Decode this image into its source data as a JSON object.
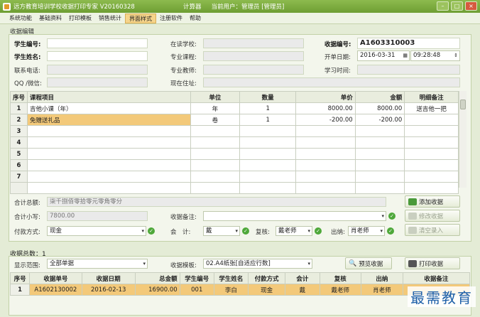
{
  "window": {
    "title": "远方教育培训学校收据打印专家 V20160328",
    "calculator": "计算器",
    "current_user": "当前用户：管理员 [管理员]"
  },
  "menu": [
    "系统功能",
    "基础资料",
    "打印模板",
    "销售统计",
    "界面样式",
    "注册软件",
    "帮助"
  ],
  "menu_active": 4,
  "editor": {
    "group_label": "收据编辑",
    "student_no_label": "学生编号:",
    "student_no": "",
    "student_name_label": "学生姓名:",
    "student_name": "",
    "phone_label": "联系电话:",
    "phone": "",
    "qq_label": "QQ /微信:",
    "qq": "",
    "school_label": "在读学校:",
    "school": "",
    "course_label": "专业课程:",
    "course": "",
    "teacher_label": "专业教师:",
    "teacher": "",
    "address_label": "现在住址:",
    "address": "",
    "receipt_no_label": "收据编号:",
    "receipt_no": "A1603310003",
    "date_label": "开单日期:",
    "date": "2016-03-31",
    "time": "09:28:48",
    "study_time_label": "学习时间:",
    "study_time": ""
  },
  "items_table": {
    "headers": [
      "序号",
      "课程项目",
      "单位",
      "数量",
      "单价",
      "金额",
      "明细备注"
    ],
    "rows": [
      {
        "no": "1",
        "item": "吉他小课（年）",
        "unit": "年",
        "qty": "1",
        "price": "8000.00",
        "amount": "8000.00",
        "note": "送吉他一把"
      },
      {
        "no": "2",
        "item": "免赠送礼品",
        "unit": "卷",
        "qty": "1",
        "price": "-200.00",
        "amount": "-200.00",
        "note": ""
      },
      {
        "no": "3",
        "item": "",
        "unit": "",
        "qty": "",
        "price": "",
        "amount": "",
        "note": ""
      },
      {
        "no": "4",
        "item": "",
        "unit": "",
        "qty": "",
        "price": "",
        "amount": "",
        "note": ""
      },
      {
        "no": "5",
        "item": "",
        "unit": "",
        "qty": "",
        "price": "",
        "amount": "",
        "note": ""
      },
      {
        "no": "6",
        "item": "",
        "unit": "",
        "qty": "",
        "price": "",
        "amount": "",
        "note": ""
      },
      {
        "no": "7",
        "item": "",
        "unit": "",
        "qty": "",
        "price": "",
        "amount": "",
        "note": ""
      }
    ]
  },
  "summary": {
    "total_upper_label": "合计总额:",
    "total_upper": "柒千捌佰零拾零元零角零分",
    "total_lower_label": "合计小写:",
    "total_lower": "7800.00",
    "remark_label": "收据备注:",
    "remark": "",
    "payment_label": "付款方式:",
    "payment": "现金",
    "accountant_label": "会　计:",
    "accountant": "戴",
    "reviewer_label": "复核:",
    "reviewer": "戴老师",
    "cashier_label": "出纳:",
    "cashier": "肖老师"
  },
  "buttons": {
    "add": "添加收据",
    "edit": "修改收据",
    "clear": "清空录入",
    "preview": "预览收据",
    "print": "打印收据"
  },
  "list": {
    "count_label": "收据总数：",
    "count": "1",
    "display_label": "显示范围:",
    "display": "全部单据",
    "template_label": "收据模板:",
    "template": "02.A4纸张[自适应行数]",
    "headers": [
      "序号",
      "收据单号",
      "收据日期",
      "总金额",
      "学生编号",
      "学生姓名",
      "付款方式",
      "会计",
      "复核",
      "出纳",
      "收据备注"
    ],
    "rows": [
      {
        "no": "1",
        "receipt_no": "A1602130002",
        "date": "2016-02-13",
        "total": "16900.00",
        "student_no": "001",
        "student_name": "李白",
        "payment": "现金",
        "accountant": "戴",
        "reviewer": "戴老师",
        "cashier": "肖老师",
        "remark": ""
      }
    ]
  },
  "watermark": "最需教育",
  "colors": {
    "title_bar": "#7aab3d",
    "selected_row": "#f3c97a",
    "background": "#e4ecd6"
  }
}
